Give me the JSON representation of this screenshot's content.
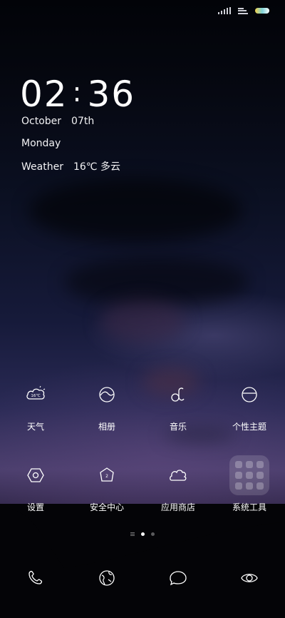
{
  "status_bar": {
    "signal_icon": "cellular-signal-icon",
    "network_icon": "network-speed-icon",
    "battery_icon": "battery-icon"
  },
  "lock_widget": {
    "hour": "02",
    "minute": "36",
    "separator": ":",
    "month": "October",
    "day": "07th",
    "weekday": "Monday",
    "weather_label": "Weather",
    "weather_value": "16℃ 多云"
  },
  "apps_row1": [
    {
      "label": "天气",
      "icon": "weather-icon",
      "icon_text": "16℃"
    },
    {
      "label": "相册",
      "icon": "gallery-icon"
    },
    {
      "label": "音乐",
      "icon": "music-icon"
    },
    {
      "label": "个性主题",
      "icon": "themes-icon"
    }
  ],
  "apps_row2": [
    {
      "label": "设置",
      "icon": "settings-icon"
    },
    {
      "label": "安全中心",
      "icon": "security-icon",
      "icon_text": "2"
    },
    {
      "label": "应用商店",
      "icon": "app-store-icon"
    },
    {
      "label": "系统工具",
      "icon": "system-tools-folder-icon"
    }
  ],
  "pager": {
    "pages": 3,
    "active_page": 2
  },
  "dock": [
    {
      "icon": "phone-icon"
    },
    {
      "icon": "browser-icon"
    },
    {
      "icon": "messages-icon"
    },
    {
      "icon": "camera-icon"
    }
  ],
  "colors": {
    "background": "#05070f",
    "text": "#ffffff",
    "folder_bg": "rgba(255,255,255,0.14)"
  }
}
